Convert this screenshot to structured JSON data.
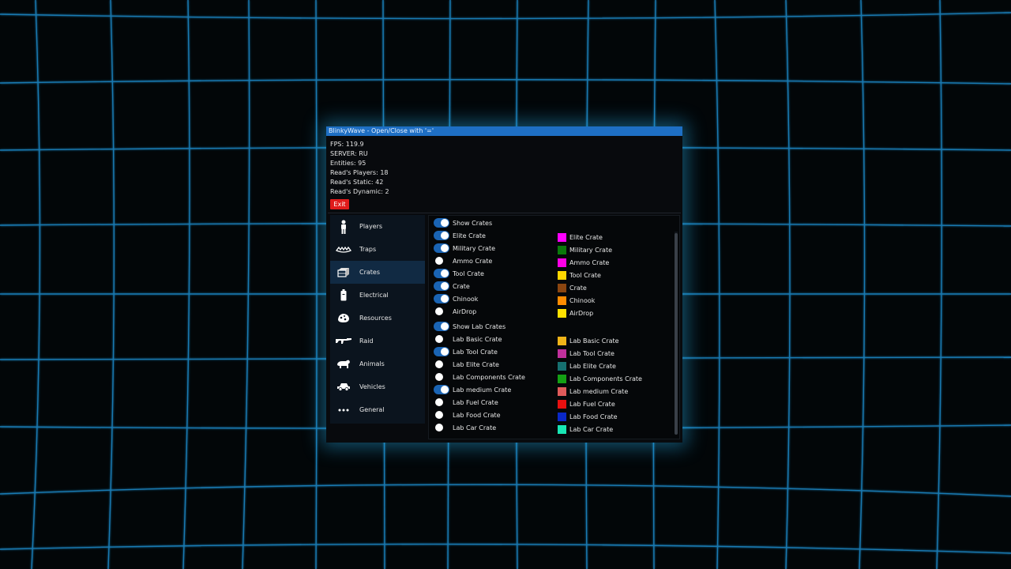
{
  "window": {
    "title": "BlinkyWave - Open/Close with '='"
  },
  "stats": [
    "FPS: 119.9",
    "SERVER: RU",
    "Entities: 95",
    "Read's Players: 18",
    "Read's Static: 42",
    "Read's Dynamic: 2"
  ],
  "exit_label": "Exit",
  "sidebar": {
    "items": [
      {
        "label": "Players",
        "icon": "person-icon",
        "active": false
      },
      {
        "label": "Traps",
        "icon": "bear-trap-icon",
        "active": false
      },
      {
        "label": "Crates",
        "icon": "crate-icon",
        "active": true
      },
      {
        "label": "Electrical",
        "icon": "battery-icon",
        "active": false
      },
      {
        "label": "Resources",
        "icon": "ore-icon",
        "active": false
      },
      {
        "label": "Raid",
        "icon": "rifle-icon",
        "active": false
      },
      {
        "label": "Animals",
        "icon": "bear-icon",
        "active": false
      },
      {
        "label": "Vehicles",
        "icon": "car-icon",
        "active": false
      },
      {
        "label": "General",
        "icon": "dots-icon",
        "active": false
      }
    ]
  },
  "toggles": [
    {
      "label": "Show Crates",
      "on": true
    },
    {
      "label": "Elite Crate",
      "on": true
    },
    {
      "label": "Military Crate",
      "on": true
    },
    {
      "label": "Ammo Crate",
      "on": false
    },
    {
      "label": "Tool Crate",
      "on": true
    },
    {
      "label": "Crate",
      "on": true
    },
    {
      "label": "Chinook",
      "on": true
    },
    {
      "label": "AirDrop",
      "on": false
    },
    {
      "label": "Show Lab Crates",
      "on": true
    },
    {
      "label": "Lab Basic Crate",
      "on": false
    },
    {
      "label": "Lab Tool Crate",
      "on": true
    },
    {
      "label": "Lab Elite Crate",
      "on": false
    },
    {
      "label": "Lab Components Crate",
      "on": false
    },
    {
      "label": "Lab medium Crate",
      "on": true
    },
    {
      "label": "Lab Fuel Crate",
      "on": false
    },
    {
      "label": "Lab Food Crate",
      "on": false
    },
    {
      "label": "Lab Car Crate",
      "on": false
    }
  ],
  "colors": [
    {
      "label": "Elite Crate",
      "color": "#ff00ff"
    },
    {
      "label": "Military Crate",
      "color": "#0a7a0a"
    },
    {
      "label": "Ammo Crate",
      "color": "#ff00e6"
    },
    {
      "label": "Tool Crate",
      "color": "#ffd700"
    },
    {
      "label": "Crate",
      "color": "#8b4510"
    },
    {
      "label": "Chinook",
      "color": "#ff8c00"
    },
    {
      "label": "AirDrop",
      "color": "#ffe100"
    },
    {
      "label": "Lab Basic Crate",
      "color": "#f0b418"
    },
    {
      "label": "Lab Tool Crate",
      "color": "#c0309c"
    },
    {
      "label": "Lab Elite Crate",
      "color": "#167070"
    },
    {
      "label": "Lab Components Crate",
      "color": "#14a014"
    },
    {
      "label": "Lab medium Crate",
      "color": "#e05a5a"
    },
    {
      "label": "Lab Fuel Crate",
      "color": "#e81010"
    },
    {
      "label": "Lab Food Crate",
      "color": "#0a28c8"
    },
    {
      "label": "Lab Car Crate",
      "color": "#18e6b4"
    }
  ]
}
